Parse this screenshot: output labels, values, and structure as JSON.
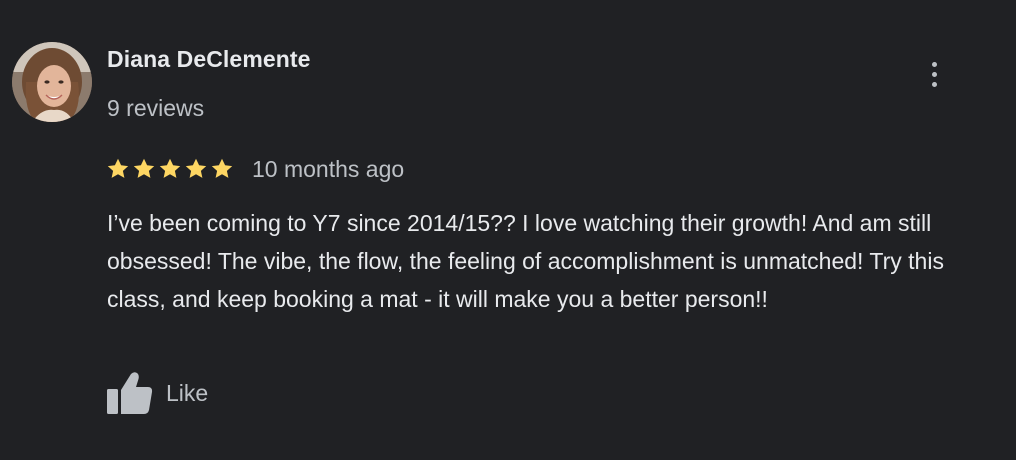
{
  "review": {
    "author_name": "Diana DeClemente",
    "review_count": "9 reviews",
    "rating": 5,
    "rating_max": 5,
    "date": "10 months ago",
    "text": "I’ve been coming to Y7 since 2014/15?? I love watching their growth! And am still obsessed! The vibe, the flow, the feeling of accomplishment is unmatched! Try this class, and keep booking a mat - it will make you a better person!!",
    "like_label": "Like"
  },
  "icons": {
    "more": "more-vert-icon",
    "star": "star-icon",
    "like": "thumb-up-icon"
  },
  "colors": {
    "background": "#202124",
    "primary_text": "#e8eaed",
    "secondary_text": "#bdc1c6",
    "star": "#fdd663"
  }
}
